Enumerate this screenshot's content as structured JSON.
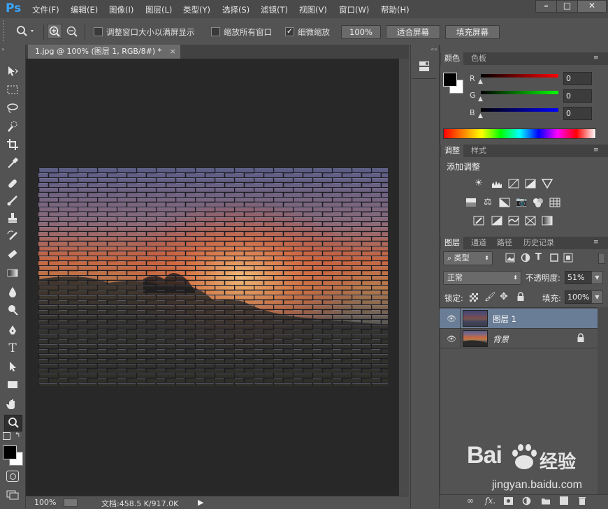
{
  "app": {
    "logo": "Ps"
  },
  "menu": [
    "文件(F)",
    "编辑(E)",
    "图像(I)",
    "图层(L)",
    "类型(Y)",
    "选择(S)",
    "滤镜(T)",
    "视图(V)",
    "窗口(W)",
    "帮助(H)"
  ],
  "window_controls": {
    "minimize": "–",
    "restore": "□",
    "close": "✕"
  },
  "options": {
    "resize_windows_label": "调整窗口大小以满屏显示",
    "zoom_all_label": "缩放所有窗口",
    "scrubby_zoom_label": "细微缩放",
    "zoom_100_button": "100%",
    "fit_screen_button": "适合屏幕",
    "fill_screen_button": "填充屏幕",
    "resize_windows_checked": false,
    "zoom_all_checked": false,
    "scrubby_zoom_checked": true
  },
  "document": {
    "tab_title": "1.jpg @ 100% (图层 1, RGB/8#) *",
    "tab_close": "×"
  },
  "status": {
    "zoom": "100%",
    "doc_info": "文档:458.5 K/917.0K"
  },
  "color_panel": {
    "tabs": [
      "颜色",
      "色板"
    ],
    "channels": [
      {
        "label": "R",
        "value": "0",
        "color": "#ff0000"
      },
      {
        "label": "G",
        "value": "0",
        "color": "#00ff00"
      },
      {
        "label": "B",
        "value": "0",
        "color": "#0000ff"
      }
    ]
  },
  "adjustments_panel": {
    "tabs": [
      "调整",
      "样式"
    ],
    "heading": "添加调整"
  },
  "layers_panel": {
    "tabs": [
      "图层",
      "通道",
      "路径",
      "历史记录"
    ],
    "filter_label": "类型",
    "blend_mode": "正常",
    "opacity_label": "不透明度:",
    "opacity_value": "51%",
    "lock_label": "锁定:",
    "fill_label": "填充:",
    "fill_value": "100%",
    "layers": [
      {
        "name": "图层 1",
        "selected": true,
        "locked": false
      },
      {
        "name": "背景",
        "selected": false,
        "locked": true
      }
    ],
    "footer_icons": [
      "link-icon",
      "fx-icon",
      "mask-icon",
      "adjustment-icon",
      "group-icon",
      "new-layer-icon",
      "trash-icon"
    ]
  },
  "watermark": {
    "brand": "Bai",
    "brand_cn": "经验",
    "url": "jingyan.baidu.com"
  },
  "colors": {
    "accent_blue": "#3aa5ff",
    "selected_layer": "#6a7d96",
    "canvas_bg": "#282828",
    "panel_bg": "#535353"
  }
}
